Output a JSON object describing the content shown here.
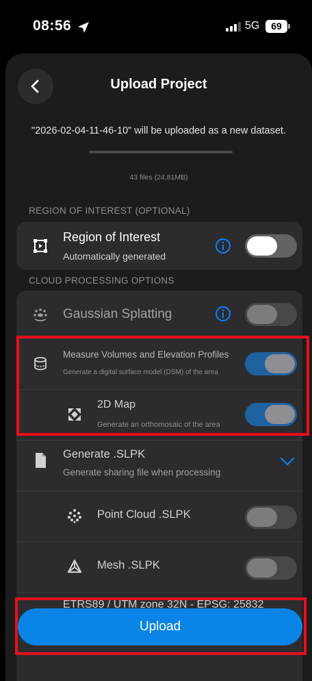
{
  "status_bar": {
    "time": "08:56",
    "network": "5G",
    "battery": "69"
  },
  "header": {
    "title": "Upload Project"
  },
  "dataset_info": "\"2026-02-04-11-46-10\" will be uploaded as a new dataset.",
  "file_count": "43 files (24,81MB)",
  "roi_section": {
    "label": "REGION OF INTEREST (OPTIONAL)",
    "title": "Region of Interest",
    "subtitle": "Automatically generated",
    "enabled": true
  },
  "cloud_section": {
    "label": "CLOUD PROCESSING OPTIONS",
    "gaussian": {
      "title": "Gaussian Splatting",
      "enabled": false
    },
    "measure": {
      "title": "Measure Volumes and Elevation Profiles",
      "subtitle": "Generate a digital surface model (DSM) of the area",
      "enabled": true
    },
    "map2d": {
      "title": "2D Map",
      "subtitle": "Generate an orthomosaic of the area",
      "enabled": true
    },
    "slpk": {
      "title": "Generate .SLPK",
      "subtitle": "Generate sharing file when processing"
    },
    "point_cloud": {
      "title": "Point Cloud .SLPK",
      "enabled": false
    },
    "mesh": {
      "title": "Mesh .SLPK",
      "enabled": false
    },
    "crs": "ETRS89 / UTM zone 32N - EPSG: 25832"
  },
  "upload_button": "Upload",
  "colors": {
    "accent": "#0a84e6",
    "toggle_on": "#1f62a0",
    "highlight": "#e8101a",
    "info_blue": "#0a84ff"
  }
}
